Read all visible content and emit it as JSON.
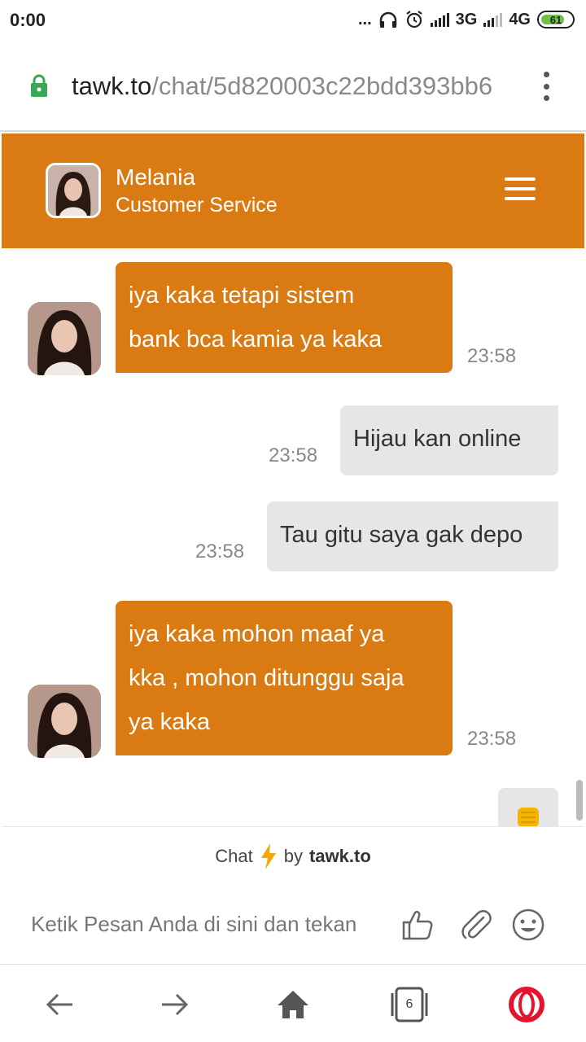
{
  "status_bar": {
    "time": "0:00",
    "dots": "...",
    "net1": "3G",
    "net2": "4G",
    "battery": "61"
  },
  "browser": {
    "url_host": "tawk.to",
    "url_path": "/chat/5d820003c22bdd393bb6"
  },
  "chat": {
    "agent_name": "Melania",
    "agent_role": "Customer Service",
    "messages": [
      {
        "from": "agent",
        "lines": [
          "iya kaka tetapi sistem",
          "bank bca kamia ya kaka"
        ],
        "time": "23:58"
      },
      {
        "from": "user",
        "text": "Hijau kan online",
        "time": "23:58"
      },
      {
        "from": "user",
        "text": "Tau gitu saya gak depo",
        "time": "23:58"
      },
      {
        "from": "agent",
        "lines": [
          "iya kaka mohon maaf ya",
          "kka , mohon ditunggu saja",
          "ya kaka"
        ],
        "time": "23:58"
      }
    ],
    "powered_prefix": "Chat",
    "powered_by": "by",
    "powered_brand": "tawk.to",
    "input_placeholder": "Ketik Pesan Anda di sini dan tekan"
  },
  "bottom_nav": {
    "tab_count": "6"
  },
  "colors": {
    "brand": "#d97a12",
    "user_bubble": "#e6e6e6"
  }
}
